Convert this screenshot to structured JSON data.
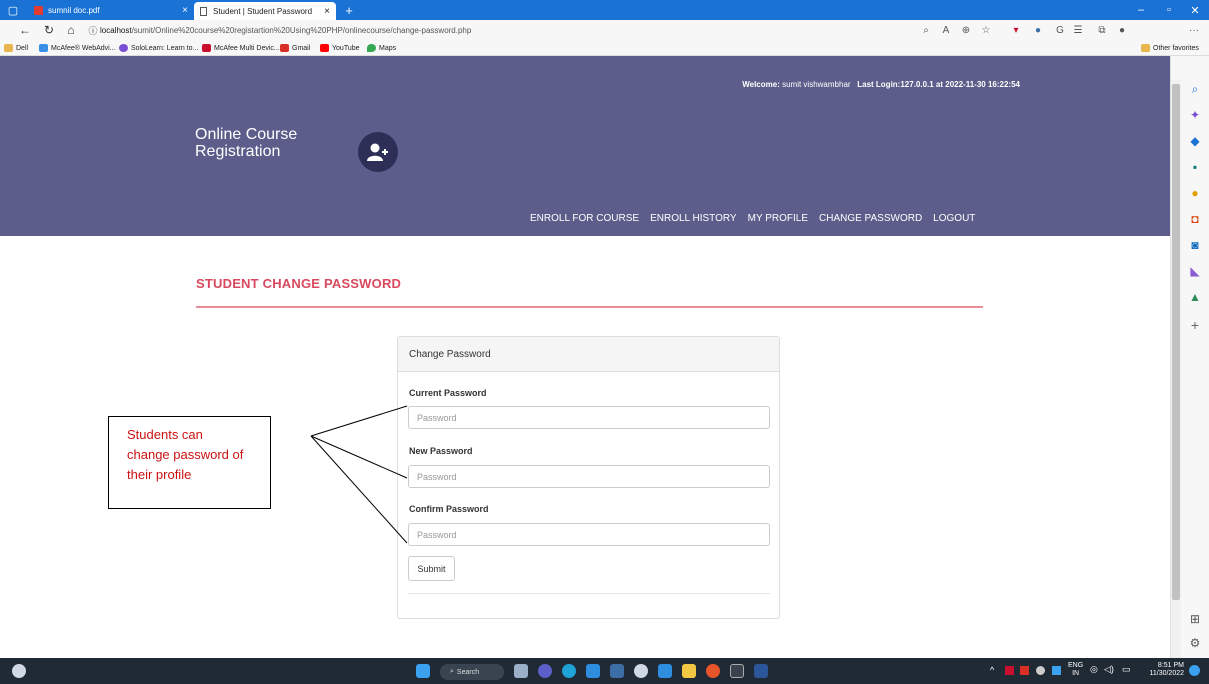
{
  "browser": {
    "tabs": [
      {
        "label": "sumnil doc.pdf",
        "active": false
      },
      {
        "label": "Student | Student Password",
        "active": true
      }
    ],
    "new_tab_symbol": "+",
    "tab_close_symbol": "×",
    "url": "localhost/sumit/Online%20course%20registartion%20Using%20PHP/onlinecourse/change-password.php",
    "url_host_part": "localhost",
    "url_rest_part": "/sumit/Online%20course%20registartion%20Using%20PHP/onlinecourse/change-password.php",
    "bookmarks": [
      {
        "label": "Dell",
        "color": "#e8b64c"
      },
      {
        "label": "McAfee® WebAdvi...",
        "color": "#c8102e"
      },
      {
        "label": "SoloLearn: Learn to...",
        "color": "#7a4ed6"
      },
      {
        "label": "McAfee Multi Devic...",
        "color": "#c8102e"
      },
      {
        "label": "Gmail",
        "color": "#d93025"
      },
      {
        "label": "YouTube",
        "color": "#ff0000"
      },
      {
        "label": "Maps",
        "color": "#34a853"
      }
    ],
    "other_favorites": "Other favorites",
    "more_symbol": "···"
  },
  "header": {
    "welcome_label": "Welcome:",
    "welcome_user": "sumit vishwambhar",
    "last_login": "Last Login:127.0.0.1 at 2022-11-30 16:22:54",
    "brand_line1": "Online Course",
    "brand_line2": "Registration",
    "nav": [
      "ENROLL FOR COURSE",
      "ENROLL HISTORY",
      "MY PROFILE",
      "CHANGE PASSWORD",
      "LOGOUT"
    ]
  },
  "main": {
    "page_heading": "STUDENT CHANGE PASSWORD",
    "panel_title": "Change Password",
    "fields": [
      {
        "label": "Current Password",
        "placeholder": "Password"
      },
      {
        "label": "New Password",
        "placeholder": "Password"
      },
      {
        "label": "Confirm Password",
        "placeholder": "Password"
      }
    ],
    "submit_label": "Submit"
  },
  "callout": {
    "lines": [
      "Students can",
      "change password of",
      "their profile"
    ]
  },
  "taskbar": {
    "search_label": "Search",
    "lang": "ENG",
    "lang_region": "IN",
    "time": "8:51 PM",
    "date": "11/30/2022"
  },
  "colors": {
    "header_bg": "#5c5d8a",
    "heading_accent": "#d8495f",
    "callout_text": "#cc1111",
    "browser_titlebar": "#1a73d4"
  }
}
